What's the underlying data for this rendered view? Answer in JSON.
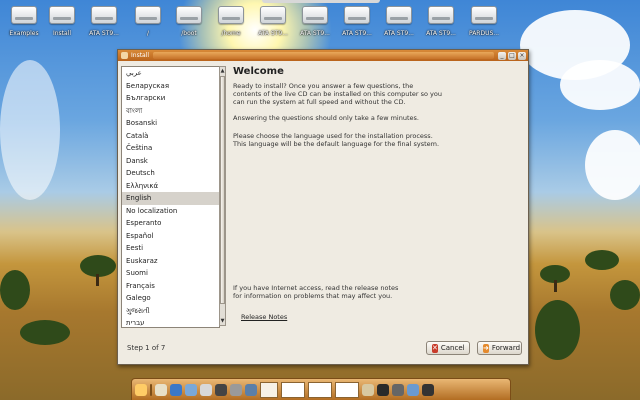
{
  "desktop": {
    "icons": [
      {
        "label": "Examples",
        "name": "examples-icon"
      },
      {
        "label": "Install",
        "name": "install-icon"
      },
      {
        "label": "ATA ST9...",
        "name": "drive-icon"
      },
      {
        "label": "/",
        "name": "drive-icon"
      },
      {
        "label": "/boot",
        "name": "drive-icon"
      },
      {
        "label": "/home",
        "name": "drive-icon"
      },
      {
        "label": "ATA ST9...",
        "name": "drive-icon"
      },
      {
        "label": "ATA ST9...",
        "name": "drive-icon"
      },
      {
        "label": "ATA ST9...",
        "name": "drive-icon"
      },
      {
        "label": "ATA ST9...",
        "name": "drive-icon"
      },
      {
        "label": "ATA ST9...",
        "name": "drive-icon"
      },
      {
        "label": "PARDUS...",
        "name": "drive-icon"
      }
    ]
  },
  "window": {
    "title": "Install",
    "controls": {
      "minimize": "_",
      "maximize": "□",
      "close": "×"
    }
  },
  "languages": [
    "عربي",
    "Беларуская",
    "Български",
    "বাংলা",
    "Bosanski",
    "Català",
    "Čeština",
    "Dansk",
    "Deutsch",
    "Ελληνικά",
    "English",
    "No localization",
    "Esperanto",
    "Español",
    "Eesti",
    "Euskaraz",
    "Suomi",
    "Français",
    "Galego",
    "ગુજરાતી",
    "עברית"
  ],
  "selected_language": "English",
  "content": {
    "heading": "Welcome",
    "para1": "Ready to install? Once you answer a few questions, the contents of the live CD can be installed on this computer so you can run the system at full speed and without the CD.",
    "para2": "Answering the questions should only take a few minutes.",
    "para3": "Please choose the language used for the installation process. This language will be the default language for the final system.",
    "para4": "If you have Internet access, read the release notes for information on problems that may affect you.",
    "release_notes": "Release Notes"
  },
  "footer": {
    "step": "Step 1 of 7",
    "cancel_label": "Cancel",
    "forward_label": "Forward"
  },
  "colors": {
    "titlebar": "#c8742a",
    "selection": "#d6d2cb",
    "cancel_icon": "#c83b2a",
    "forward_icon": "#e48a2e"
  }
}
